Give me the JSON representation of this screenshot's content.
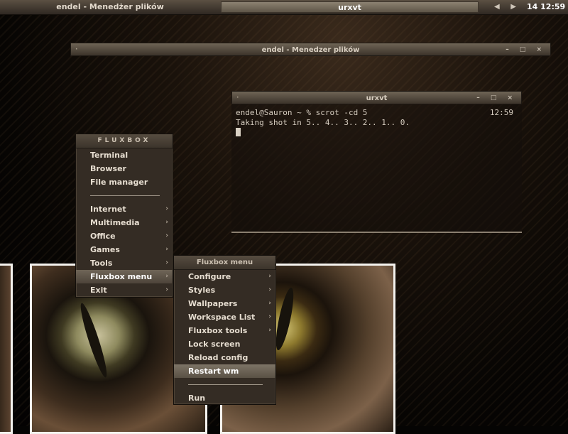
{
  "toolbar": {
    "tasks": [
      "endel - Menedżer plików",
      "urxvt"
    ],
    "workspace_prev": "◀",
    "workspace_next": "▶",
    "clock": "14 12:59"
  },
  "file_manager_window": {
    "title": "endel - Menedzer plików"
  },
  "terminal_window": {
    "title": "urxvt",
    "prompt": "endel@Sauron ~ % scrot -cd 5",
    "output": "Taking shot in 5.. 4.. 3.. 2.. 1.. 0.",
    "right_clock": "12:59"
  },
  "window_controls": {
    "dot": "·",
    "buttons": "– □ ×"
  },
  "main_menu": {
    "title": "FLUXBOX",
    "items": [
      "Terminal",
      "Browser",
      "File manager"
    ],
    "items2": [
      "Internet",
      "Multimedia",
      "Office",
      "Games",
      "Tools",
      "Fluxbox menu",
      "Exit"
    ],
    "submenu_arrow": "›"
  },
  "sub_menu": {
    "title": "Fluxbox menu",
    "items": [
      "Configure",
      "Styles",
      "Wallpapers",
      "Workspace List",
      "Fluxbox tools",
      "Lock screen",
      "Reload config",
      "Restart wm"
    ],
    "items2": [
      "Run"
    ]
  }
}
